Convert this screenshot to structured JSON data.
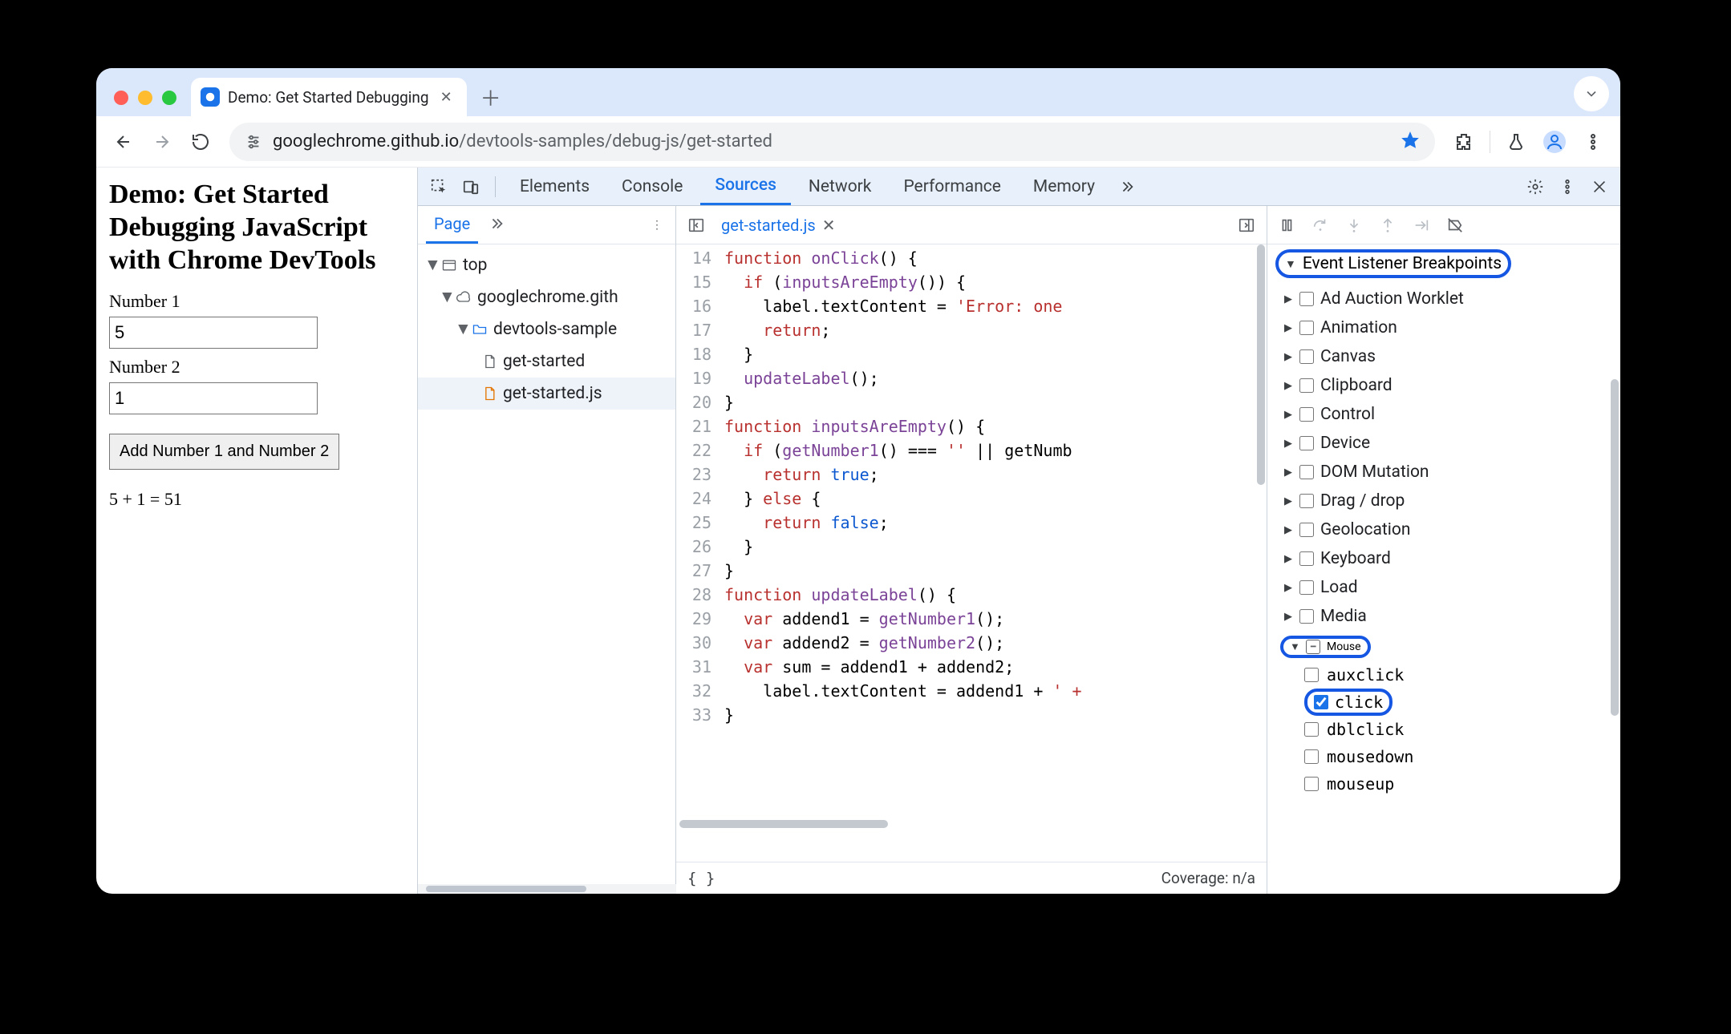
{
  "browser": {
    "tab_title": "Demo: Get Started Debugging",
    "url_host": "googlechrome.github.io",
    "url_path": "/devtools-samples/debug-js/get-started"
  },
  "page": {
    "heading": "Demo: Get Started Debugging JavaScript with Chrome DevTools",
    "label_num1": "Number 1",
    "value_num1": "5",
    "label_num2": "Number 2",
    "value_num2": "1",
    "button_label": "Add Number 1 and Number 2",
    "result_text": "5 + 1 = 51"
  },
  "devtools": {
    "tabs": [
      "Elements",
      "Console",
      "Sources",
      "Network",
      "Performance",
      "Memory"
    ],
    "active_tab": "Sources",
    "navigator": {
      "tab": "Page",
      "tree": {
        "top": "top",
        "domain": "googlechrome.gith",
        "folder": "devtools-sample",
        "file_html": "get-started",
        "file_js": "get-started.js"
      }
    },
    "editor": {
      "open_file": "get-started.js",
      "first_line_no": 14,
      "lines": [
        "function onClick() {",
        "  if (inputsAreEmpty()) {",
        "    label.textContent = 'Error: one",
        "    return;",
        "  }",
        "  updateLabel();",
        "}",
        "function inputsAreEmpty() {",
        "  if (getNumber1() === '' || getNumb",
        "    return true;",
        "  } else {",
        "    return false;",
        "  }",
        "}",
        "function updateLabel() {",
        "  var addend1 = getNumber1();",
        "  var addend2 = getNumber2();",
        "  var sum = addend1 + addend2;",
        "    label.textContent = addend1 + ' +",
        "}"
      ],
      "footer_coverage": "Coverage: n/a"
    },
    "debugger": {
      "section_title": "Event Listener Breakpoints",
      "categories": [
        {
          "name": "Ad Auction Worklet",
          "expanded": false,
          "checked": false
        },
        {
          "name": "Animation",
          "expanded": false,
          "checked": false
        },
        {
          "name": "Canvas",
          "expanded": false,
          "checked": false
        },
        {
          "name": "Clipboard",
          "expanded": false,
          "checked": false
        },
        {
          "name": "Control",
          "expanded": false,
          "checked": false
        },
        {
          "name": "Device",
          "expanded": false,
          "checked": false
        },
        {
          "name": "DOM Mutation",
          "expanded": false,
          "checked": false
        },
        {
          "name": "Drag / drop",
          "expanded": false,
          "checked": false
        },
        {
          "name": "Geolocation",
          "expanded": false,
          "checked": false
        },
        {
          "name": "Keyboard",
          "expanded": false,
          "checked": false
        },
        {
          "name": "Load",
          "expanded": false,
          "checked": false
        },
        {
          "name": "Media",
          "expanded": false,
          "checked": false
        }
      ],
      "mouse": {
        "name": "Mouse",
        "mixed": true,
        "events": [
          {
            "name": "auxclick",
            "checked": false
          },
          {
            "name": "click",
            "checked": true
          },
          {
            "name": "dblclick",
            "checked": false
          },
          {
            "name": "mousedown",
            "checked": false
          },
          {
            "name": "mouseup",
            "checked": false
          }
        ]
      }
    }
  }
}
